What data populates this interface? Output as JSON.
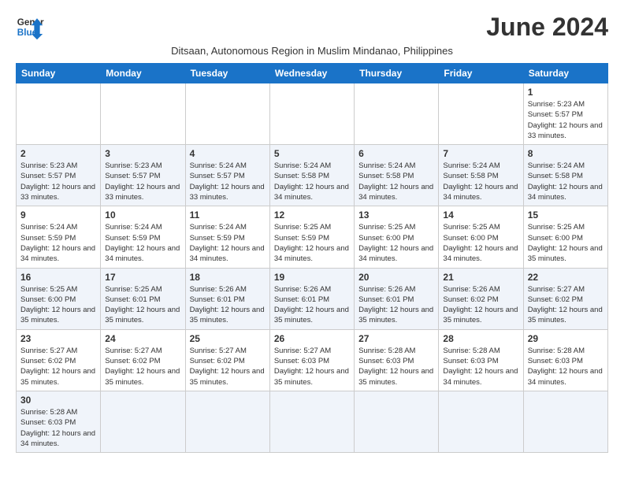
{
  "header": {
    "logo_line1": "General",
    "logo_line2": "Blue",
    "month_title": "June 2024",
    "subtitle": "Ditsaan, Autonomous Region in Muslim Mindanao, Philippines"
  },
  "days_of_week": [
    "Sunday",
    "Monday",
    "Tuesday",
    "Wednesday",
    "Thursday",
    "Friday",
    "Saturday"
  ],
  "weeks": [
    [
      {
        "day": "",
        "info": ""
      },
      {
        "day": "",
        "info": ""
      },
      {
        "day": "",
        "info": ""
      },
      {
        "day": "",
        "info": ""
      },
      {
        "day": "",
        "info": ""
      },
      {
        "day": "",
        "info": ""
      },
      {
        "day": "1",
        "info": "Sunrise: 5:23 AM\nSunset: 5:57 PM\nDaylight: 12 hours and 33 minutes."
      }
    ],
    [
      {
        "day": "2",
        "info": "Sunrise: 5:23 AM\nSunset: 5:57 PM\nDaylight: 12 hours and 33 minutes."
      },
      {
        "day": "3",
        "info": "Sunrise: 5:23 AM\nSunset: 5:57 PM\nDaylight: 12 hours and 33 minutes."
      },
      {
        "day": "4",
        "info": "Sunrise: 5:24 AM\nSunset: 5:57 PM\nDaylight: 12 hours and 33 minutes."
      },
      {
        "day": "5",
        "info": "Sunrise: 5:24 AM\nSunset: 5:58 PM\nDaylight: 12 hours and 34 minutes."
      },
      {
        "day": "6",
        "info": "Sunrise: 5:24 AM\nSunset: 5:58 PM\nDaylight: 12 hours and 34 minutes."
      },
      {
        "day": "7",
        "info": "Sunrise: 5:24 AM\nSunset: 5:58 PM\nDaylight: 12 hours and 34 minutes."
      },
      {
        "day": "8",
        "info": "Sunrise: 5:24 AM\nSunset: 5:58 PM\nDaylight: 12 hours and 34 minutes."
      }
    ],
    [
      {
        "day": "9",
        "info": "Sunrise: 5:24 AM\nSunset: 5:59 PM\nDaylight: 12 hours and 34 minutes."
      },
      {
        "day": "10",
        "info": "Sunrise: 5:24 AM\nSunset: 5:59 PM\nDaylight: 12 hours and 34 minutes."
      },
      {
        "day": "11",
        "info": "Sunrise: 5:24 AM\nSunset: 5:59 PM\nDaylight: 12 hours and 34 minutes."
      },
      {
        "day": "12",
        "info": "Sunrise: 5:25 AM\nSunset: 5:59 PM\nDaylight: 12 hours and 34 minutes."
      },
      {
        "day": "13",
        "info": "Sunrise: 5:25 AM\nSunset: 6:00 PM\nDaylight: 12 hours and 34 minutes."
      },
      {
        "day": "14",
        "info": "Sunrise: 5:25 AM\nSunset: 6:00 PM\nDaylight: 12 hours and 34 minutes."
      },
      {
        "day": "15",
        "info": "Sunrise: 5:25 AM\nSunset: 6:00 PM\nDaylight: 12 hours and 35 minutes."
      }
    ],
    [
      {
        "day": "16",
        "info": "Sunrise: 5:25 AM\nSunset: 6:00 PM\nDaylight: 12 hours and 35 minutes."
      },
      {
        "day": "17",
        "info": "Sunrise: 5:25 AM\nSunset: 6:01 PM\nDaylight: 12 hours and 35 minutes."
      },
      {
        "day": "18",
        "info": "Sunrise: 5:26 AM\nSunset: 6:01 PM\nDaylight: 12 hours and 35 minutes."
      },
      {
        "day": "19",
        "info": "Sunrise: 5:26 AM\nSunset: 6:01 PM\nDaylight: 12 hours and 35 minutes."
      },
      {
        "day": "20",
        "info": "Sunrise: 5:26 AM\nSunset: 6:01 PM\nDaylight: 12 hours and 35 minutes."
      },
      {
        "day": "21",
        "info": "Sunrise: 5:26 AM\nSunset: 6:02 PM\nDaylight: 12 hours and 35 minutes."
      },
      {
        "day": "22",
        "info": "Sunrise: 5:27 AM\nSunset: 6:02 PM\nDaylight: 12 hours and 35 minutes."
      }
    ],
    [
      {
        "day": "23",
        "info": "Sunrise: 5:27 AM\nSunset: 6:02 PM\nDaylight: 12 hours and 35 minutes."
      },
      {
        "day": "24",
        "info": "Sunrise: 5:27 AM\nSunset: 6:02 PM\nDaylight: 12 hours and 35 minutes."
      },
      {
        "day": "25",
        "info": "Sunrise: 5:27 AM\nSunset: 6:02 PM\nDaylight: 12 hours and 35 minutes."
      },
      {
        "day": "26",
        "info": "Sunrise: 5:27 AM\nSunset: 6:03 PM\nDaylight: 12 hours and 35 minutes."
      },
      {
        "day": "27",
        "info": "Sunrise: 5:28 AM\nSunset: 6:03 PM\nDaylight: 12 hours and 35 minutes."
      },
      {
        "day": "28",
        "info": "Sunrise: 5:28 AM\nSunset: 6:03 PM\nDaylight: 12 hours and 34 minutes."
      },
      {
        "day": "29",
        "info": "Sunrise: 5:28 AM\nSunset: 6:03 PM\nDaylight: 12 hours and 34 minutes."
      }
    ],
    [
      {
        "day": "30",
        "info": "Sunrise: 5:28 AM\nSunset: 6:03 PM\nDaylight: 12 hours and 34 minutes."
      },
      {
        "day": "",
        "info": ""
      },
      {
        "day": "",
        "info": ""
      },
      {
        "day": "",
        "info": ""
      },
      {
        "day": "",
        "info": ""
      },
      {
        "day": "",
        "info": ""
      },
      {
        "day": "",
        "info": ""
      }
    ]
  ]
}
